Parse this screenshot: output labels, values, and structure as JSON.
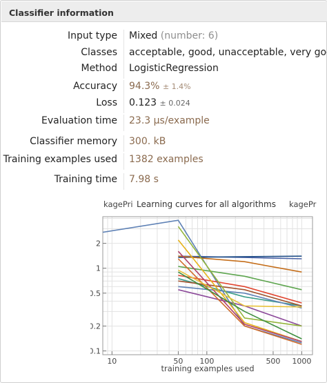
{
  "panel": {
    "title": "Classifier information"
  },
  "rows": [
    {
      "label": "Input type",
      "value": "Mixed",
      "extra": "(number: 6)"
    },
    {
      "label": "Classes",
      "value": "acceptable, good, unacceptable, very good"
    },
    {
      "label": "Method",
      "value": "LogisticRegression"
    },
    {
      "label": "Accuracy",
      "value": "94.3%",
      "extra": "± 1.4%"
    },
    {
      "label": "Loss",
      "value": "0.123",
      "extra": "± 0.024"
    },
    {
      "label": "Evaluation time",
      "value": "23.3 µs/example"
    },
    {
      "label": "Classifier memory",
      "value": "300. kB"
    },
    {
      "label": "Training examples used",
      "value": "1382 examples"
    },
    {
      "label": "Training time",
      "value": "7.98 s"
    }
  ],
  "colors": {
    "accent_value": "#8a6a4e",
    "header_bg": "#ededed"
  },
  "chart_data": {
    "type": "line",
    "title": "Learning curves for all algorithms",
    "left_clipped_label": "kagePri",
    "right_clipped_label": "kagePr",
    "xlabel": "training examples used",
    "ylabel": "",
    "xscale": "log",
    "yscale": "log",
    "xlim": [
      8,
      1300
    ],
    "ylim": [
      0.09,
      4.2
    ],
    "xticks": [
      10,
      50,
      100,
      500,
      1000
    ],
    "yticks": [
      0.1,
      0.2,
      0.5,
      1,
      2
    ],
    "grid": true,
    "series": [
      {
        "color": "#5e81b5",
        "x": [
          5,
          50,
          250,
          1000
        ],
        "y": [
          2.5,
          3.8,
          0.2,
          0.125
        ]
      },
      {
        "color": "#4a62a6",
        "x": [
          50,
          250,
          1000
        ],
        "y": [
          1.4,
          1.35,
          1.3
        ]
      },
      {
        "color": "#1f4e87",
        "x": [
          50,
          250,
          1000
        ],
        "y": [
          1.35,
          1.38,
          1.4
        ]
      },
      {
        "color": "#c56e1a",
        "x": [
          50,
          250,
          1000
        ],
        "y": [
          1.4,
          1.2,
          0.9
        ]
      },
      {
        "color": "#5da54e",
        "x": [
          50,
          250,
          1000
        ],
        "y": [
          1.05,
          0.8,
          0.55
        ]
      },
      {
        "color": "#e1452f",
        "x": [
          50,
          250,
          1000
        ],
        "y": [
          0.82,
          0.6,
          0.38
        ]
      },
      {
        "color": "#3b9d8a",
        "x": [
          50,
          250,
          1000
        ],
        "y": [
          0.75,
          0.45,
          0.35
        ]
      },
      {
        "color": "#a0522d",
        "x": [
          50,
          250,
          1000
        ],
        "y": [
          0.7,
          0.55,
          0.35
        ]
      },
      {
        "color": "#5e81b5",
        "x": [
          50,
          250,
          1000
        ],
        "y": [
          0.6,
          0.5,
          0.33
        ]
      },
      {
        "color": "#8c4a9a",
        "x": [
          50,
          250,
          1000
        ],
        "y": [
          0.55,
          0.35,
          0.2
        ]
      },
      {
        "color": "#93b53a",
        "x": [
          50,
          250,
          1000
        ],
        "y": [
          3.2,
          0.25,
          0.2
        ]
      },
      {
        "color": "#e6b219",
        "x": [
          50,
          250,
          1000
        ],
        "y": [
          2.2,
          0.22,
          0.13
        ]
      },
      {
        "color": "#d06b2a",
        "x": [
          50,
          250,
          1000
        ],
        "y": [
          1.3,
          0.2,
          0.12
        ]
      },
      {
        "color": "#b0416a",
        "x": [
          50,
          250,
          1000
        ],
        "y": [
          1.6,
          0.21,
          0.13
        ]
      },
      {
        "color": "#3f8f3f",
        "x": [
          50,
          250,
          1000
        ],
        "y": [
          0.9,
          0.3,
          0.14
        ]
      },
      {
        "color": "#e8c23a",
        "x": [
          50,
          250,
          1000
        ],
        "y": [
          0.95,
          0.35,
          0.34
        ]
      }
    ]
  }
}
